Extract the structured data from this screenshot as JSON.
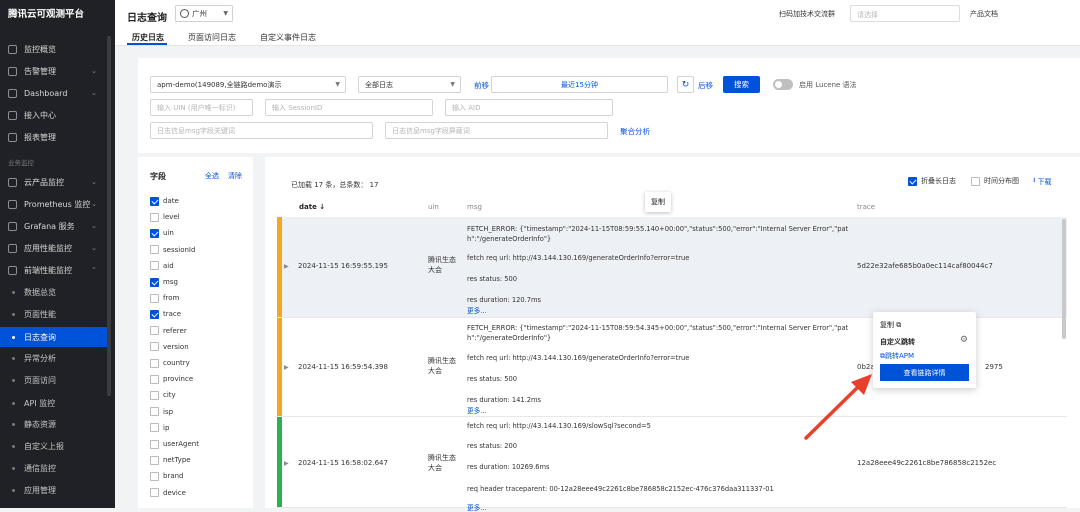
{
  "brand": "腾讯云可观测平台",
  "nav": {
    "items": [
      {
        "label": "监控概览",
        "chev": ""
      },
      {
        "label": "告警管理",
        "chev": "⌄"
      },
      {
        "label": "Dashboard",
        "chev": "⌄"
      },
      {
        "label": "接入中心",
        "chev": ""
      },
      {
        "label": "报表管理",
        "chev": ""
      }
    ],
    "group": "业务监控",
    "items2": [
      {
        "label": "云产品监控",
        "chev": "⌄"
      },
      {
        "label": "Prometheus 监控",
        "chev": "⌄"
      },
      {
        "label": "Grafana 服务",
        "chev": "⌄"
      },
      {
        "label": "应用性能监控",
        "chev": "⌄"
      },
      {
        "label": "前端性能监控",
        "chev": "⌃"
      }
    ],
    "subitems": [
      "数据总览",
      "页面性能",
      "日志查询",
      "异常分析",
      "页面访问",
      "API 监控",
      "静态资源",
      "自定义上报",
      "通信监控",
      "应用管理"
    ],
    "active_sub": "日志查询"
  },
  "header": {
    "title": "日志查询",
    "region": "广州",
    "tabs": [
      "历史日志",
      "页面访问日志",
      "自定义事件日志"
    ],
    "qr_text": "扫码加技术交流群",
    "product_select_placeholder": "请选择",
    "product_text": "产品文档"
  },
  "filters": {
    "project": "apm-demo(149089,全链路demo演示",
    "log_type": "全部日志",
    "prev": "前移",
    "time_range": "最近15分钟",
    "next": "后移",
    "search": "搜索",
    "lucene": "启用 Lucene 语法",
    "uin_placeholder": "输入 UIN (用户唯一标识)",
    "session_placeholder": "输入 SessionID",
    "aid_placeholder": "输入 AID",
    "msg_placeholder": "日志信息msg字段关键词",
    "msg_exclude_placeholder": "日志信息msg字段屏蔽词",
    "aggregate": "聚合分析"
  },
  "fields": {
    "title": "字段",
    "select_all": "全选",
    "clear": "清除",
    "list": [
      {
        "name": "date",
        "checked": true
      },
      {
        "name": "level",
        "checked": false
      },
      {
        "name": "uin",
        "checked": true
      },
      {
        "name": "sessionId",
        "checked": false
      },
      {
        "name": "aid",
        "checked": false
      },
      {
        "name": "msg",
        "checked": true
      },
      {
        "name": "from",
        "checked": false
      },
      {
        "name": "trace",
        "checked": true
      },
      {
        "name": "referer",
        "checked": false
      },
      {
        "name": "version",
        "checked": false
      },
      {
        "name": "country",
        "checked": false
      },
      {
        "name": "province",
        "checked": false
      },
      {
        "name": "city",
        "checked": false
      },
      {
        "name": "isp",
        "checked": false
      },
      {
        "name": "ip",
        "checked": false
      },
      {
        "name": "userAgent",
        "checked": false
      },
      {
        "name": "netType",
        "checked": false
      },
      {
        "name": "brand",
        "checked": false
      },
      {
        "name": "device",
        "checked": false
      }
    ]
  },
  "table": {
    "loaded_text": "已加载 17 条，总条数： 17",
    "fold_long": "折叠长日志",
    "time_dist": "时间分布图",
    "download": "下载",
    "columns": [
      "date ↓",
      "uin",
      "msg",
      "trace"
    ],
    "tooltip": "复制",
    "rows": [
      {
        "date": "2024-11-15 16:59:55.195",
        "uin": "腾讯生态大会",
        "msg": [
          "FETCH_ERROR: {\"timestamp\":\"2024-11-15T08:59:55.140+00:00\",\"status\":500,\"error\":\"Internal Server Error\",\"pat",
          "h\":\"/generateOrderInfo\"}",
          "fetch req url: http://43.144.130.169/generateOrderInfo?error=true",
          "res status: 500",
          "res duration: 120.7ms"
        ],
        "more": "更多...",
        "trace": "5d22e32afe685b0a0ec114caf80044c7",
        "color": "#f5a623"
      },
      {
        "date": "2024-11-15 16:59:54.398",
        "uin": "腾讯生态大会",
        "msg": [
          "FETCH_ERROR: {\"timestamp\":\"2024-11-15T08:59:54.345+00:00\",\"status\":500,\"error\":\"Internal Server Error\",\"pat",
          "h\":\"/generateOrderInfo\"}",
          "fetch req url: http://43.144.130.169/generateOrderInfo?error=true",
          "res status: 500",
          "res duration: 141.2ms"
        ],
        "more": "更多...",
        "trace": "0b2a",
        "trace_end": "2975",
        "color": "#f5a623"
      },
      {
        "date": "2024-11-15 16:58:02.647",
        "uin": "腾讯生态大会",
        "msg": [
          "fetch req url: http://43.144.130.169/slowSql?second=5",
          "res status: 200",
          "res duration: 10269.6ms",
          "req header traceparent: 00-12a28eee49c2261c8be786858c2152ec-476c376daa311337-01"
        ],
        "more": "更多...",
        "trace": "12a28eee49c2261c8be786858c2152ec",
        "color": "#2bb24c"
      }
    ]
  },
  "popup": {
    "copy": "复制",
    "custom_jump": "自定义跳转",
    "jump_apm": "跳转APM",
    "view_trace": "查看链路详情"
  },
  "colors": {
    "accent": "#0052d9",
    "sidebar": "#1f2126",
    "warning": "#f5a623",
    "success": "#2bb24c",
    "annotation": "#e8402c"
  }
}
